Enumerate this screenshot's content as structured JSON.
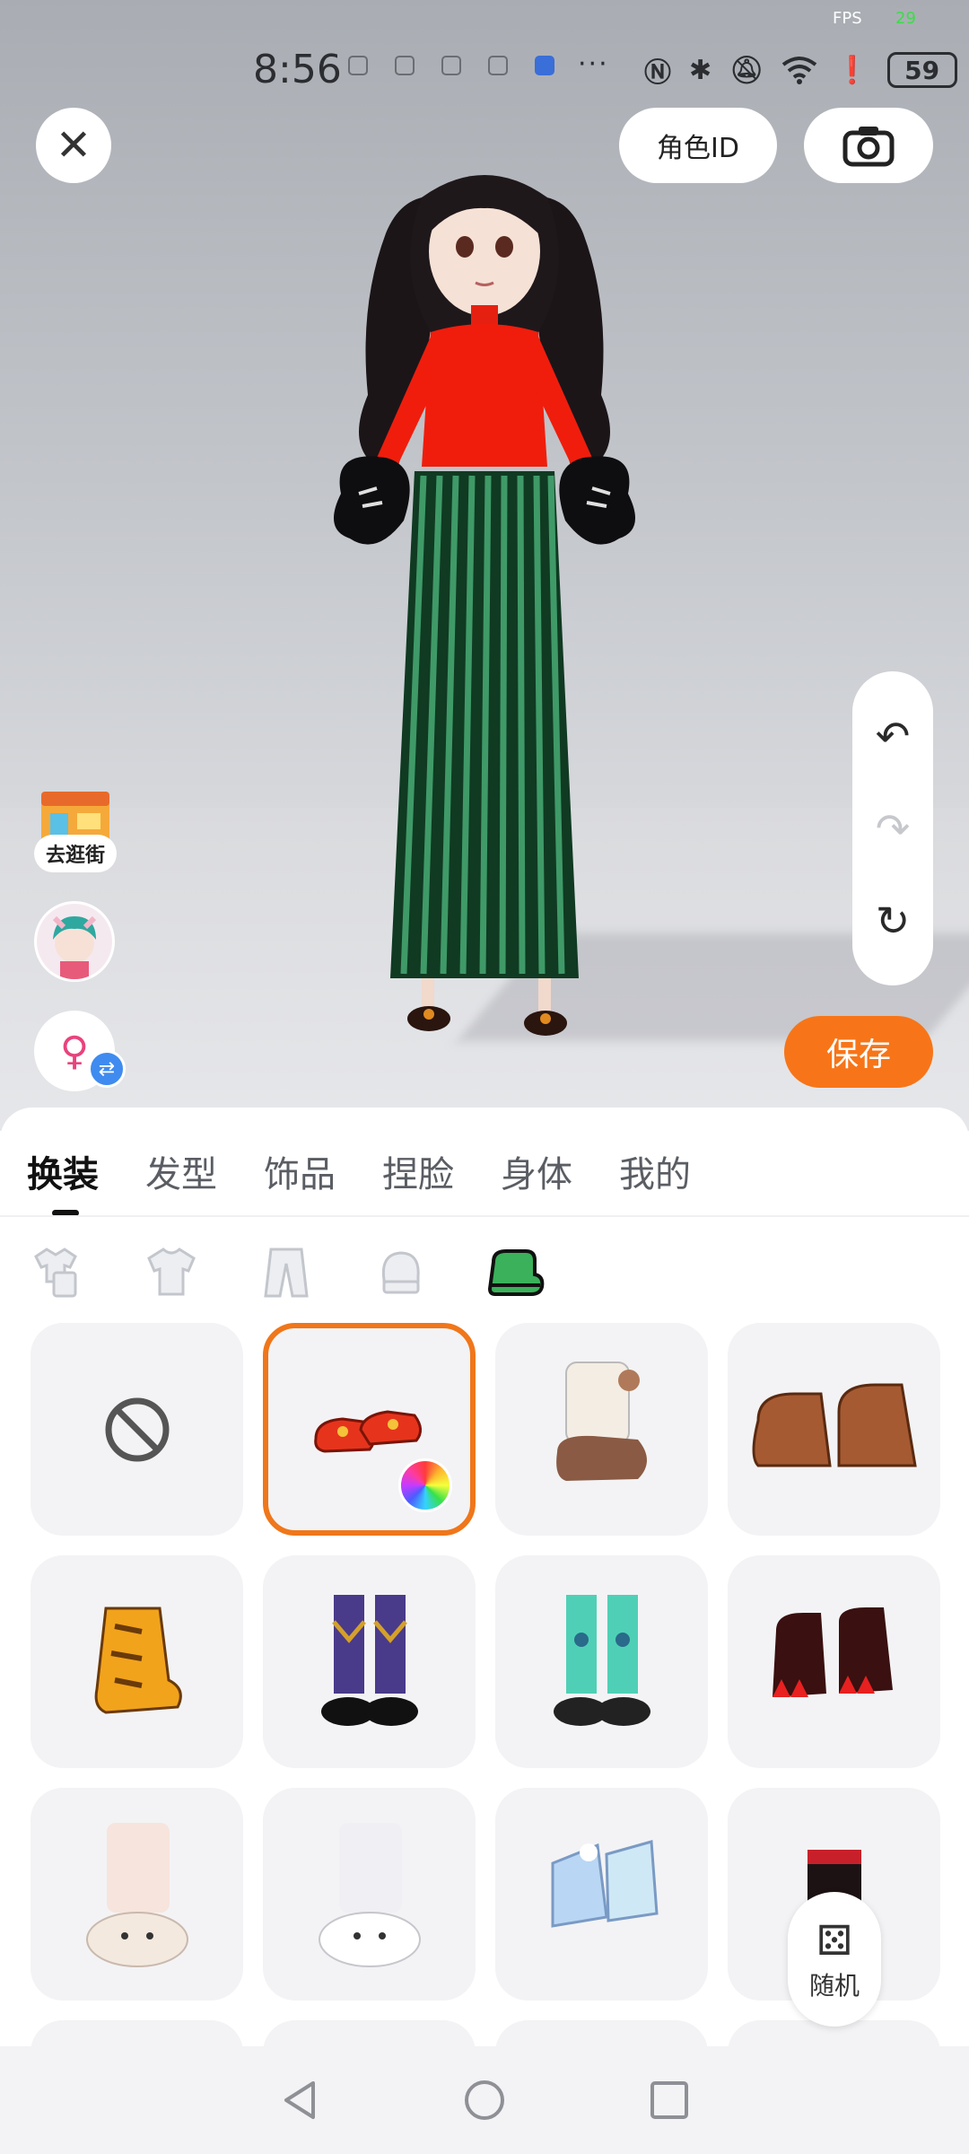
{
  "status_bar": {
    "fps_label": "FPS",
    "fps_value": "29",
    "time": "8:56",
    "overflow": "···",
    "battery": "59"
  },
  "top": {
    "close_icon": "close-icon",
    "role_id_label": "角色ID",
    "camera_icon": "camera-icon"
  },
  "left": {
    "shop_label": "去逛街",
    "gender_symbol": "♀",
    "swap_symbol": "⇄"
  },
  "right": {
    "undo_icon": "undo-icon",
    "redo_icon": "redo-icon",
    "reset_icon": "reset-icon",
    "save_label": "保存"
  },
  "tabs": [
    {
      "label": "换装",
      "active": true
    },
    {
      "label": "发型",
      "active": false
    },
    {
      "label": "饰品",
      "active": false
    },
    {
      "label": "捏脸",
      "active": false
    },
    {
      "label": "身体",
      "active": false
    },
    {
      "label": "我的",
      "active": false
    }
  ],
  "categories": [
    {
      "icon": "outfit-set-icon",
      "active": false
    },
    {
      "icon": "top-icon",
      "active": false
    },
    {
      "icon": "pants-icon",
      "active": false
    },
    {
      "icon": "gloves-icon",
      "active": false
    },
    {
      "icon": "shoes-icon",
      "active": true
    }
  ],
  "items": [
    {
      "name": "none",
      "icon": "no-item-icon"
    },
    {
      "name": "red-flat-shoes",
      "selected": true,
      "color_picker": true
    },
    {
      "name": "fluffy-bear-boots"
    },
    {
      "name": "brown-paw-shoes"
    },
    {
      "name": "orange-tiger-boots"
    },
    {
      "name": "argyle-socks-shoes"
    },
    {
      "name": "teal-bear-socks-shoes"
    },
    {
      "name": "red-claw-shoes"
    },
    {
      "name": "pink-bunny-slippers"
    },
    {
      "name": "white-bunny-slippers"
    },
    {
      "name": "holographic-boots"
    },
    {
      "name": "black-red-boots"
    }
  ],
  "random": {
    "dice": "⚄",
    "label": "随机"
  },
  "colors": {
    "accent": "#f77518",
    "selected_border": "#f0761a",
    "shoes_icon": "#3ab15a"
  }
}
